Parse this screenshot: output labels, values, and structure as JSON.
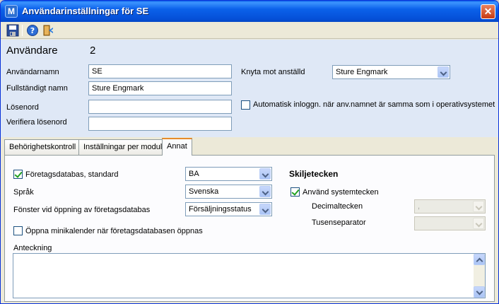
{
  "window": {
    "title": "Användarinställningar för SE",
    "icon_letter": "M"
  },
  "toolbar": {
    "icons": [
      "save-icon",
      "help-icon",
      "exit-icon"
    ]
  },
  "user": {
    "header_label": "Användare",
    "user_number": "2",
    "username_label": "Användarnamn",
    "username_value": "SE",
    "fullname_label": "Fullständigt namn",
    "fullname_value": "Sture Engmark",
    "password_label": "Lösenord",
    "password_value": "",
    "verify_password_label": "Verifiera lösenord",
    "verify_password_value": "",
    "link_employee_label": "Knyta mot anställd",
    "link_employee_value": "Sture Engmark",
    "auto_login_label": "Automatisk inloggn. när anv.namnet är samma som i operativsystemet",
    "auto_login_checked": false
  },
  "tabs": [
    {
      "label": "Behörighetskontroll",
      "active": false
    },
    {
      "label": "Inställningar per modul",
      "active": false
    },
    {
      "label": "Annat",
      "active": true
    }
  ],
  "annat": {
    "company_db_label": "Företagsdatabas, standard",
    "company_db_checked": true,
    "company_db_value": "BA",
    "language_label": "Språk",
    "language_value": "Svenska",
    "window_on_open_label": "Fönster vid öppning av företagsdatabas",
    "window_on_open_value": "Försäljningsstatus",
    "mini_calendar_label": "Öppna minikalender när företagsdatabasen öppnas",
    "mini_calendar_checked": false,
    "separators_heading": "Skiljetecken",
    "use_system_label": "Använd systemtecken",
    "use_system_checked": true,
    "decimal_label": "Decimaltecken",
    "decimal_value": ",",
    "thousands_label": "Tusenseparator",
    "thousands_value": "",
    "note_label": "Anteckning",
    "note_value": ""
  },
  "colors": {
    "titlebar": "#0550d8",
    "panel_blue": "#dfe8f6",
    "active_tab_accent": "#e68b2c"
  }
}
